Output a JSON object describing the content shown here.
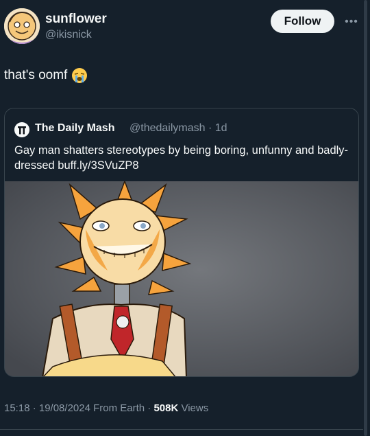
{
  "user": {
    "name": "sunflower",
    "handle": "@ikisnick"
  },
  "actions": {
    "follow_label": "Follow",
    "more_label": "•••"
  },
  "tweet": {
    "text": "that's oomf",
    "emoji_icon": "crying-face-emoji"
  },
  "quote": {
    "name": "The Daily Mash",
    "meta": "@thedailymash · 1d",
    "text": "Gay man shatters stereotypes by being boring, unfunny and badly-dressed buff.ly/3SVuZP8",
    "image_icon": "sun-character-illustration"
  },
  "footer": {
    "time": "15:18 · 19/08/2024 From Earth · ",
    "views_count": "508K",
    "views_label": " Views"
  },
  "colors": {
    "background": "#15202b",
    "text": "#f7f9f9",
    "secondary": "#8b98a5",
    "border": "#38444d"
  }
}
